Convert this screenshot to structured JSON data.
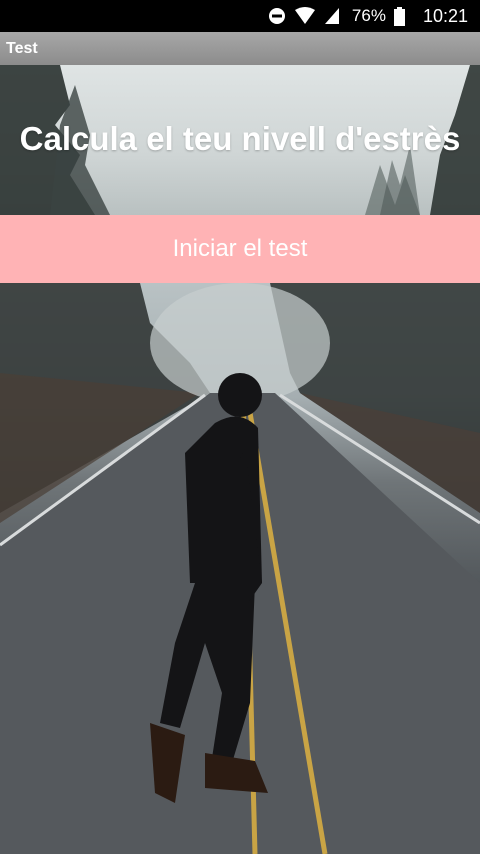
{
  "status_bar": {
    "battery": "76%",
    "time": "10:21",
    "icons": [
      "do-not-disturb-icon",
      "wifi-icon",
      "signal-icon",
      "battery-icon"
    ]
  },
  "app_bar": {
    "title": "Test"
  },
  "hero": {
    "title": "Calcula el teu nivell d'estrès"
  },
  "actions": {
    "start_label": "Iniciar el test"
  },
  "colors": {
    "button_bg": "#ffb3b5",
    "app_bar_bg": "#999999"
  }
}
